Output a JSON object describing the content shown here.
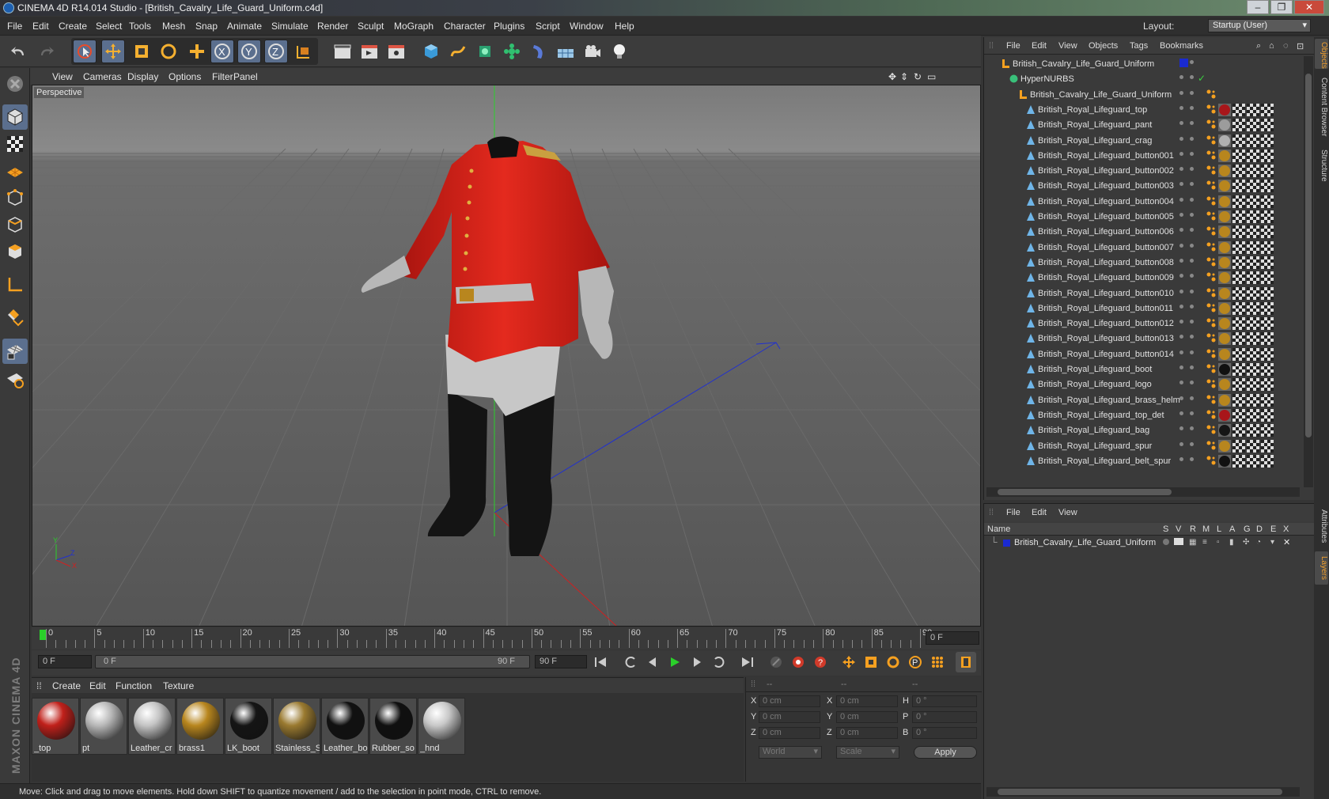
{
  "window": {
    "title": "CINEMA 4D R14.014 Studio - [British_Cavalry_Life_Guard_Uniform.c4d]",
    "buttons": [
      "–",
      "❐",
      "✕"
    ]
  },
  "menubar": {
    "items": [
      "File",
      "Edit",
      "Create",
      "Select",
      "Tools",
      "Mesh",
      "Snap",
      "Animate",
      "Simulate",
      "Render",
      "Sculpt",
      "MoGraph",
      "Character",
      "Plugins",
      "Script",
      "Window",
      "Help"
    ],
    "layout_label": "Layout:",
    "layout_value": "Startup (User)"
  },
  "viewport": {
    "menus": [
      "View",
      "Cameras",
      "Display",
      "Options",
      "Filter",
      "Panel"
    ],
    "label": "Perspective",
    "axis_labels": {
      "y": "Y",
      "x": "X",
      "z": "Z"
    }
  },
  "timeline": {
    "ticks": [
      "0",
      "5",
      "10",
      "15",
      "20",
      "25",
      "30",
      "35",
      "40",
      "45",
      "50",
      "55",
      "60",
      "65",
      "70",
      "75",
      "80",
      "85",
      "90"
    ],
    "current_frame_box": "0 F",
    "start_field": "0 F",
    "range_start": "0 F",
    "range_end": "90 F",
    "end_field": "90 F"
  },
  "material_manager": {
    "menus": [
      "Create",
      "Edit",
      "Function",
      "Texture"
    ],
    "materials": [
      {
        "label": "_top",
        "color": "#c0201a"
      },
      {
        "label": "pt",
        "color": "#b8b8b8"
      },
      {
        "label": "Leather_cr",
        "color": "#c4c4c4"
      },
      {
        "label": "brass1",
        "color": "#b8861e"
      },
      {
        "label": "LK_boot",
        "color": "#151515"
      },
      {
        "label": "Stainless_S",
        "color": "#9a7a30"
      },
      {
        "label": "Leather_bo",
        "color": "#111111"
      },
      {
        "label": "Rubber_so",
        "color": "#101010"
      },
      {
        "label": "_hnd",
        "color": "#c8c8c8"
      }
    ]
  },
  "coordinates": {
    "headers": [
      "--",
      "--",
      "--"
    ],
    "rows": [
      {
        "l1": "X",
        "v1": "0 cm",
        "l2": "X",
        "v2": "0 cm",
        "l3": "H",
        "v3": "0 °"
      },
      {
        "l1": "Y",
        "v1": "0 cm",
        "l2": "Y",
        "v2": "0 cm",
        "l3": "P",
        "v3": "0 °"
      },
      {
        "l1": "Z",
        "v1": "0 cm",
        "l2": "Z",
        "v2": "0 cm",
        "l3": "B",
        "v3": "0 °"
      }
    ],
    "mode1": "World",
    "mode2": "Scale",
    "apply_label": "Apply"
  },
  "status": "Move: Click and drag to move elements. Hold down SHIFT to quantize movement / add to the selection in point mode, CTRL to remove.",
  "maxon_logo": "MAXON CINEMA 4D",
  "object_manager": {
    "menus": [
      "File",
      "Edit",
      "View",
      "Objects",
      "Tags",
      "Bookmarks"
    ],
    "root": "British_Cavalry_Life_Guard_Uniform",
    "hypernurbs": "HyperNURBS",
    "group": "British_Cavalry_Life_Guard_Uniform",
    "children": [
      {
        "name": "British_Royal_Lifeguard_top",
        "mat": "#a8161a"
      },
      {
        "name": "British_Royal_Lifeguard_pant",
        "mat": "#9c9c9c"
      },
      {
        "name": "British_Royal_Lifeguard_crag",
        "mat": "#b0b0b0"
      },
      {
        "name": "British_Royal_Lifeguard_button001",
        "mat": "#b8861e"
      },
      {
        "name": "British_Royal_Lifeguard_button002",
        "mat": "#b8861e"
      },
      {
        "name": "British_Royal_Lifeguard_button003",
        "mat": "#b8861e"
      },
      {
        "name": "British_Royal_Lifeguard_button004",
        "mat": "#b8861e"
      },
      {
        "name": "British_Royal_Lifeguard_button005",
        "mat": "#b8861e"
      },
      {
        "name": "British_Royal_Lifeguard_button006",
        "mat": "#b8861e"
      },
      {
        "name": "British_Royal_Lifeguard_button007",
        "mat": "#b8861e"
      },
      {
        "name": "British_Royal_Lifeguard_button008",
        "mat": "#b8861e"
      },
      {
        "name": "British_Royal_Lifeguard_button009",
        "mat": "#b8861e"
      },
      {
        "name": "British_Royal_Lifeguard_button010",
        "mat": "#b8861e"
      },
      {
        "name": "British_Royal_Lifeguard_button011",
        "mat": "#b8861e"
      },
      {
        "name": "British_Royal_Lifeguard_button012",
        "mat": "#b8861e"
      },
      {
        "name": "British_Royal_Lifeguard_button013",
        "mat": "#b8861e"
      },
      {
        "name": "British_Royal_Lifeguard_button014",
        "mat": "#b8861e"
      },
      {
        "name": "British_Royal_Lifeguard_boot",
        "mat": "#111111"
      },
      {
        "name": "British_Royal_Lifeguard_logo",
        "mat": "#b8861e"
      },
      {
        "name": "British_Royal_Lifeguard_brass_helm",
        "mat": "#b8861e"
      },
      {
        "name": "British_Royal_Lifeguard_top_det",
        "mat": "#a8161a"
      },
      {
        "name": "British_Royal_Lifeguard_bag",
        "mat": "#151515"
      },
      {
        "name": "British_Royal_Lifeguard_spur",
        "mat": "#b8861e"
      },
      {
        "name": "British_Royal_Lifeguard_belt_spur",
        "mat": "#111111"
      }
    ]
  },
  "layer_manager": {
    "menus": [
      "File",
      "Edit",
      "View"
    ],
    "columns": [
      "Name",
      "S",
      "V",
      "R",
      "M",
      "L",
      "A",
      "G",
      "D",
      "E",
      "X"
    ],
    "layer": {
      "name": "British_Cavalry_Life_Guard_Uniform",
      "color": "#1a2ad0"
    }
  },
  "side_tabs": [
    "Objects",
    "Content Browser",
    "Structure",
    "Attributes",
    "Layers"
  ],
  "colors": {
    "accent": "#5b6f8e",
    "coat": "#d8231b",
    "highlight": "#f0a030"
  }
}
